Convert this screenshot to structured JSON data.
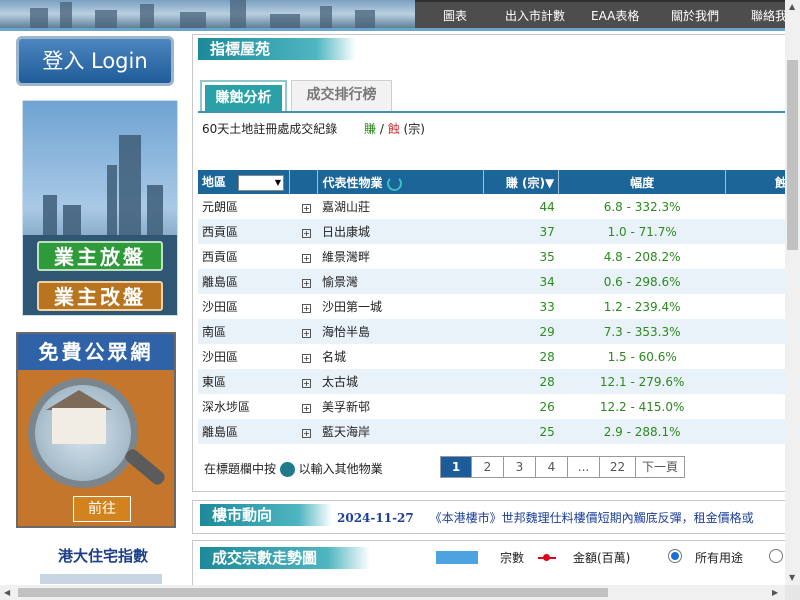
{
  "nav": {
    "items": [
      "圖表",
      "出入市計數",
      "EAA表格",
      "關於我們",
      "聯絡我"
    ]
  },
  "sidebar": {
    "login": "登入 Login",
    "ad_owner": {
      "list_button": "業主放盤",
      "edit_button": "業主改盤"
    },
    "ad_public": {
      "title": "免費公眾網",
      "go_button": "前往"
    },
    "hku_title": "港大住宅指數"
  },
  "index_section": {
    "title": "指標屋苑",
    "tabs": [
      "賺蝕分析",
      "成交排行榜"
    ],
    "subtitle": "60天土地註冊處成交紀錄",
    "legend": {
      "gain": "賺",
      "sep": " / ",
      "loss": "蝕",
      "unit": " (宗)"
    },
    "columns": [
      "地區",
      "代表性物業",
      "賺 (宗)▼",
      "幅度",
      "蝕"
    ],
    "rows": [
      {
        "district": "元朗區",
        "estate": "嘉湖山莊",
        "gain": "44",
        "range": "6.8  -  332.3%"
      },
      {
        "district": "西貢區",
        "estate": "日出康城",
        "gain": "37",
        "range": "1.0  -  71.7%"
      },
      {
        "district": "西貢區",
        "estate": "維景灣畔",
        "gain": "35",
        "range": "4.8  -  208.2%"
      },
      {
        "district": "離島區",
        "estate": "愉景灣",
        "gain": "34",
        "range": "0.6  -  298.6%"
      },
      {
        "district": "沙田區",
        "estate": "沙田第一城",
        "gain": "33",
        "range": "1.2  -  239.4%"
      },
      {
        "district": "南區",
        "estate": "海怡半島",
        "gain": "29",
        "range": "7.3  -  353.3%"
      },
      {
        "district": "沙田區",
        "estate": "名城",
        "gain": "28",
        "range": "1.5  -  60.6%"
      },
      {
        "district": "東區",
        "estate": "太古城",
        "gain": "28",
        "range": "12.1  -  279.6%"
      },
      {
        "district": "深水埗區",
        "estate": "美孚新邨",
        "gain": "26",
        "range": "12.2  -  415.0%"
      },
      {
        "district": "離島區",
        "estate": "藍天海岸",
        "gain": "25",
        "range": "2.9  -  288.1%"
      }
    ],
    "hint_pre": "在標題欄中按",
    "hint_post": "以輸入其他物業",
    "pager": [
      "1",
      "2",
      "3",
      "4",
      "...",
      "22",
      "下一頁"
    ]
  },
  "market_section": {
    "title": "樓市動向",
    "date": "2024-11-27",
    "headline": "《本港樓市》世邦魏理仕料樓價短期內觸底反彈，租金價格或"
  },
  "trend_section": {
    "title": "成交宗數走勢圖",
    "legend_count": "宗數",
    "legend_amount": "金額(百萬)",
    "radio_all": "所有用途"
  },
  "colors": {
    "header_blue": "#1c6599",
    "teal": "#2aa1a6",
    "gain_green": "#2b8a1e",
    "loss_red": "#c43030"
  }
}
